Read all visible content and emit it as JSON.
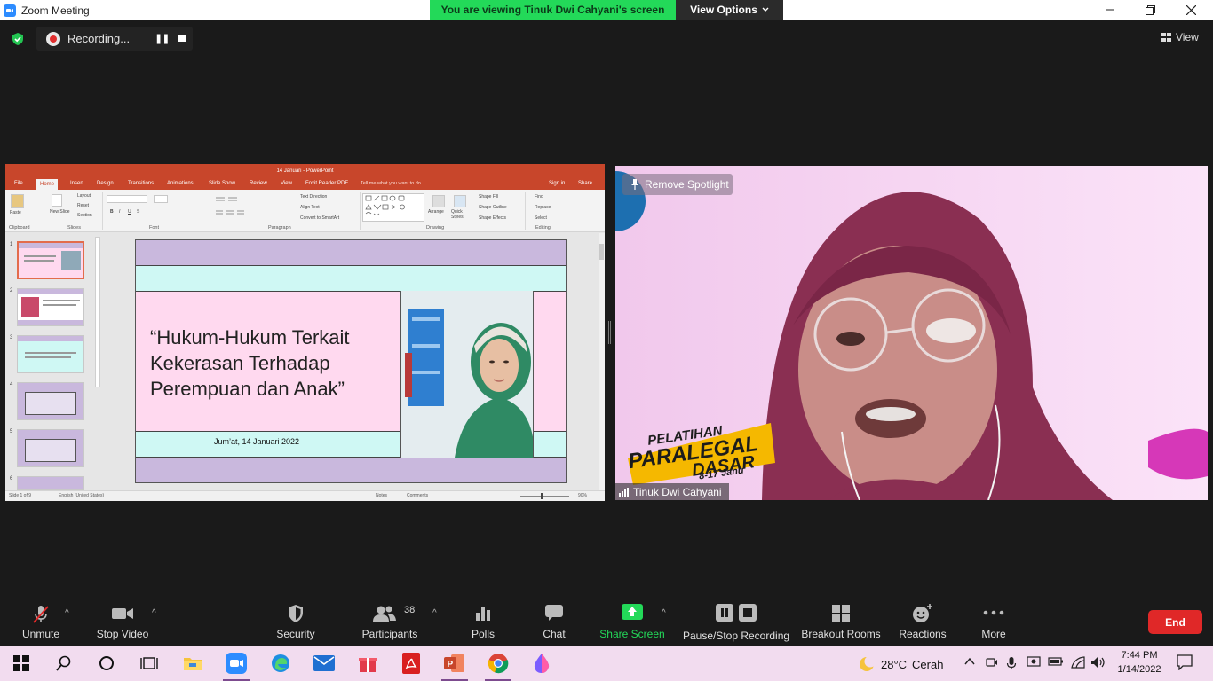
{
  "window": {
    "title": "Zoom Meeting",
    "viewing_banner": "You are viewing Tinuk Dwi Cahyani's screen",
    "view_options": "View Options"
  },
  "topbar": {
    "recording_label": "Recording...",
    "view_label": "View"
  },
  "shared_screen": {
    "ppt_title": "14 Januari - PowerPoint",
    "tabs": [
      "File",
      "Home",
      "Insert",
      "Design",
      "Transitions",
      "Animations",
      "Slide Show",
      "Review",
      "View",
      "Foxit Reader PDF"
    ],
    "active_tab": "Home",
    "tell_me": "Tell me what you want to do...",
    "sign_in": "Sign in",
    "share_label": "Share",
    "ribbon": {
      "paste": "Paste",
      "layout": "Layout",
      "reset": "Reset",
      "section": "Section",
      "new_slide": "New Slide",
      "text_direction": "Text Direction",
      "align_text": "Align Text",
      "convert_smartart": "Convert to SmartArt",
      "arrange": "Arrange",
      "quick_styles": "Quick Styles",
      "shape_fill": "Shape Fill",
      "shape_outline": "Shape Outline",
      "shape_effects": "Shape Effects",
      "find": "Find",
      "replace": "Replace",
      "select": "Select",
      "groups": [
        "Clipboard",
        "Slides",
        "Font",
        "Paragraph",
        "Drawing",
        "Editing"
      ]
    },
    "thumbnails": [
      "1",
      "2",
      "3",
      "4",
      "5",
      "6"
    ],
    "slide": {
      "title": "“Hukum-Hukum Terkait Kekerasan Terhadap Perempuan dan Anak”",
      "date": "Jum’at, 14 Januari 2022"
    },
    "status": {
      "slide_of": "Slide 1 of 9",
      "language": "English (United States)",
      "notes": "Notes",
      "comments": "Comments",
      "zoom": "90%"
    }
  },
  "video": {
    "spotlight_label": "Remove Spotlight",
    "participant_name": "Tinuk Dwi Cahyani",
    "banner_line1": "PELATIHAN",
    "banner_line2": "PARALEGAL",
    "banner_line3": "DASAR",
    "banner_line4": "8-17 Janu"
  },
  "toolbar": {
    "unmute": "Unmute",
    "stop_video": "Stop Video",
    "security": "Security",
    "participants": "Participants",
    "participant_count": "38",
    "polls": "Polls",
    "chat": "Chat",
    "share_screen": "Share Screen",
    "pause_stop_recording": "Pause/Stop Recording",
    "breakout_rooms": "Breakout Rooms",
    "reactions": "Reactions",
    "more": "More",
    "end": "End"
  },
  "taskbar": {
    "weather_temp": "28°C",
    "weather_desc": "Cerah",
    "time": "7:44 PM",
    "date": "1/14/2022"
  },
  "colors": {
    "zoom_green": "#23d959",
    "end_red": "#e02828",
    "ppt_orange": "#c8462b",
    "slide_pink": "#ffd9ef",
    "slide_lavender": "#c9b8dd",
    "slide_aqua": "#cff8f4"
  }
}
